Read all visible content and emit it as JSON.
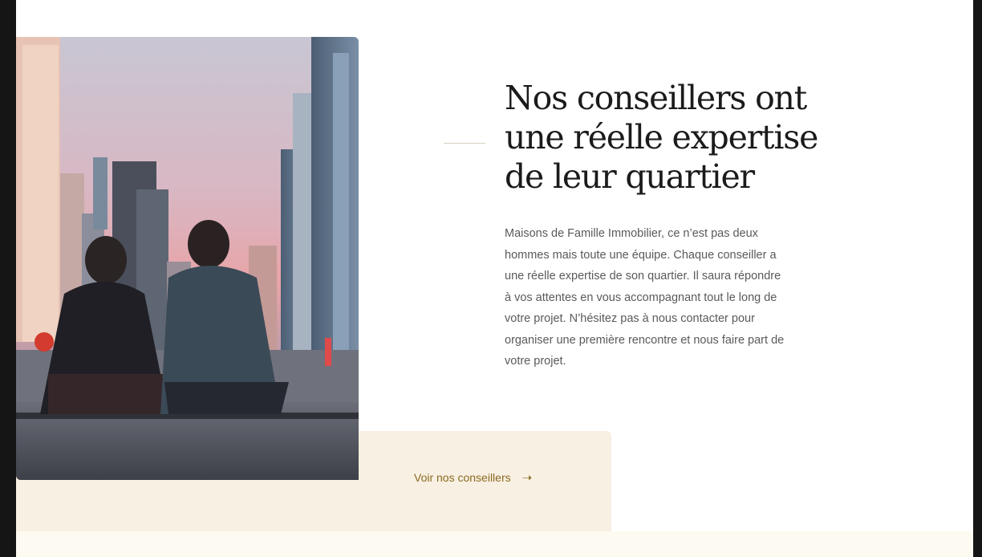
{
  "section": {
    "title_lines": [
      "Nos conseillers ont",
      "une réelle expertise",
      "de leur quartier"
    ],
    "description_lines": [
      "Maisons de Famille Immobilier, ce n’est pas deux",
      "hommes mais toute une équipe. Chaque conseiller a",
      "une réelle expertise de son quartier. Il saura répondre",
      "à vos attentes en vous accompagnant tout le long de",
      "votre projet. N’hésitez pas à nous contacter pour",
      "organiser une première rencontre et nous faire part de",
      "votre projet."
    ],
    "cta_label": "Voir nos conseillers",
    "cta_icon": "arrow-right-icon"
  },
  "colors": {
    "accent": "#8a6a22",
    "cream": "#f8f0e2",
    "title": "#1b1b1b",
    "body_text": "#5a5a5a"
  }
}
